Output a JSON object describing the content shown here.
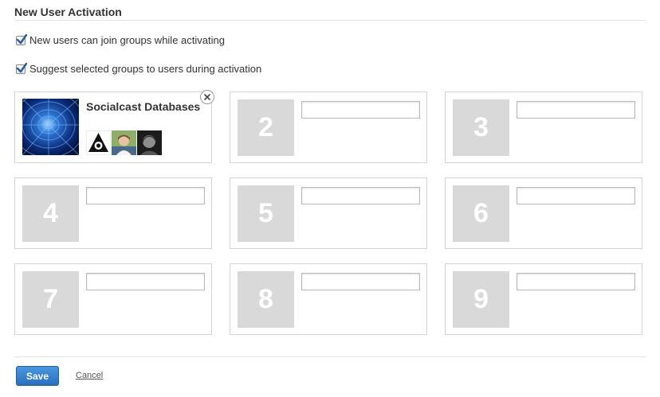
{
  "section": {
    "title": "New User Activation"
  },
  "options": [
    {
      "label": "New users can join groups while activating",
      "checked": true
    },
    {
      "label": "Suggest selected groups to users during activation",
      "checked": true
    }
  ],
  "slots": {
    "first": {
      "group_name": "Socialcast Databases",
      "remove_icon": "close-icon"
    },
    "empty": [
      {
        "number": "2",
        "value": ""
      },
      {
        "number": "3",
        "value": ""
      },
      {
        "number": "4",
        "value": ""
      },
      {
        "number": "5",
        "value": ""
      },
      {
        "number": "6",
        "value": ""
      },
      {
        "number": "7",
        "value": ""
      },
      {
        "number": "8",
        "value": ""
      },
      {
        "number": "9",
        "value": ""
      }
    ]
  },
  "actions": {
    "save_label": "Save",
    "cancel_label": "Cancel"
  },
  "colors": {
    "accent": "#2a6fbd",
    "placeholder_bg": "#d9d9d9",
    "border": "#d3d3d3"
  }
}
